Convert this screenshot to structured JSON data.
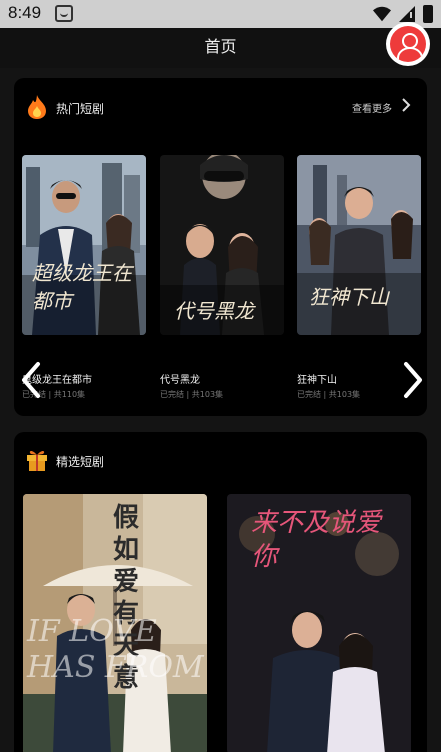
{
  "status_bar": {
    "time": "8:49"
  },
  "header": {
    "title": "首页"
  },
  "hot": {
    "title": "热门短剧",
    "see_more": "查看更多",
    "items": [
      {
        "title": "鬼级龙王在都市",
        "meta": "已完结 | 共110集",
        "poster_text": "超级龙王在都市"
      },
      {
        "title": "代号黑龙",
        "meta": "已完结 | 共103集",
        "poster_text": "代号黑龙"
      },
      {
        "title": "狂神下山",
        "meta": "已完结 | 共103集",
        "poster_text": "狂神下山"
      }
    ]
  },
  "selected": {
    "title": "精选短剧",
    "items": [
      {
        "poster_text": "假如爱有天意",
        "poster_en": "IF LOVE HAS FROM"
      },
      {
        "poster_text": "来不及说爱你"
      }
    ]
  },
  "colors": {
    "accent_red": "#ee3b3b",
    "flame": "#ff7a1a",
    "gift": "#f2b531"
  }
}
